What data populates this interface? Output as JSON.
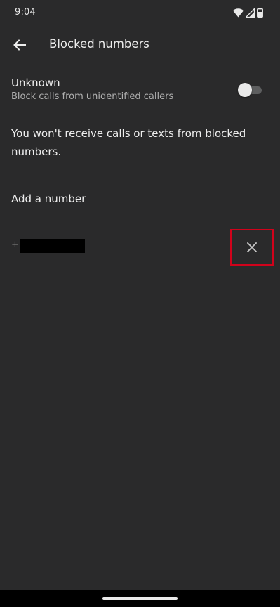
{
  "status_bar": {
    "time": "9:04",
    "icons": [
      "wifi-icon",
      "signal-icon",
      "battery-icon"
    ]
  },
  "app_bar": {
    "back_icon": "arrow-left-icon",
    "title": "Blocked numbers"
  },
  "unknown_setting": {
    "title": "Unknown",
    "subtitle": "Block calls from unidentified callers",
    "toggle_on": false
  },
  "info": {
    "text": "You won't receive calls or texts from blocked numbers."
  },
  "add_number": {
    "label": "Add a number"
  },
  "blocked_list": [
    {
      "prefix": "+1",
      "remove_icon": "close-icon"
    }
  ],
  "colors": {
    "background": "#2a2a2b",
    "text_primary": "#ededed",
    "text_secondary": "#b0b0b0",
    "highlight_border": "#d0021b"
  }
}
